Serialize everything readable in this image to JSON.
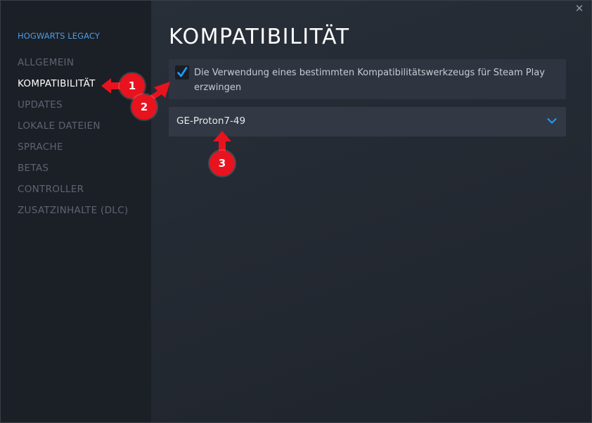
{
  "window": {
    "close_glyph": "✕"
  },
  "sidebar": {
    "game_title": "HOGWARTS LEGACY",
    "items": [
      {
        "label": "ALLGEMEIN",
        "active": false
      },
      {
        "label": "KOMPATIBILITÄT",
        "active": true
      },
      {
        "label": "UPDATES",
        "active": false
      },
      {
        "label": "LOKALE DATEIEN",
        "active": false
      },
      {
        "label": "SPRACHE",
        "active": false
      },
      {
        "label": "BETAS",
        "active": false
      },
      {
        "label": "CONTROLLER",
        "active": false
      },
      {
        "label": "ZUSATZINHALTE (DLC)",
        "active": false
      }
    ]
  },
  "main": {
    "title": "KOMPATIBILITÄT",
    "force_tool": {
      "checked": true,
      "label": "Die Verwendung eines bestimmten Kompatibilitätswerkzeugs für Steam Play erzwingen"
    },
    "tool_select": {
      "selected": "GE-Proton7-49"
    }
  },
  "annotations": [
    {
      "number": "1"
    },
    {
      "number": "2"
    },
    {
      "number": "3"
    }
  ],
  "colors": {
    "accent": "#1a9fff",
    "annotation": "#e8131e",
    "game_title": "#4d9de0"
  },
  "icons": {
    "checkbox": "checkmark-icon",
    "dropdown": "chevron-down-icon",
    "close": "close-icon"
  }
}
